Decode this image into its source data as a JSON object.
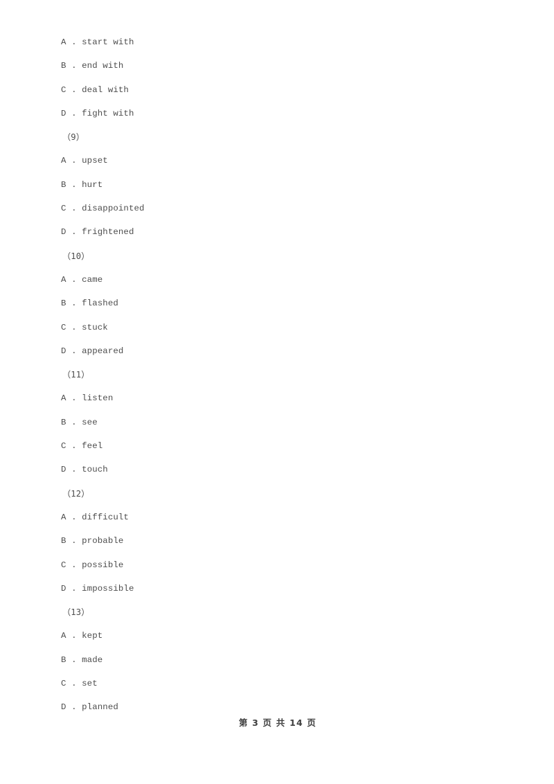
{
  "document": {
    "page_background": "#ffffff",
    "text_color": "#4d4d4d"
  },
  "content": {
    "blocks": [
      {
        "options": [
          "A . start with",
          "B . end with",
          "C . deal with",
          "D . fight with"
        ],
        "number": "（9）"
      },
      {
        "options": [
          "A . upset",
          "B . hurt",
          "C . disappointed",
          "D . frightened"
        ],
        "number": "（10）"
      },
      {
        "options": [
          "A . came",
          "B . flashed",
          "C . stuck",
          "D . appeared"
        ],
        "number": "（11）"
      },
      {
        "options": [
          "A . listen",
          "B . see",
          "C . feel",
          "D . touch"
        ],
        "number": "（12）"
      },
      {
        "options": [
          "A . difficult",
          "B . probable",
          "C . possible",
          "D . impossible"
        ],
        "number": "（13）"
      },
      {
        "options": [
          "A . kept",
          "B . made",
          "C . set",
          "D . planned"
        ],
        "number": null
      }
    ]
  },
  "footer": {
    "page_label": "第 3 页 共 14 页",
    "current_page": 3,
    "total_pages": 14
  }
}
